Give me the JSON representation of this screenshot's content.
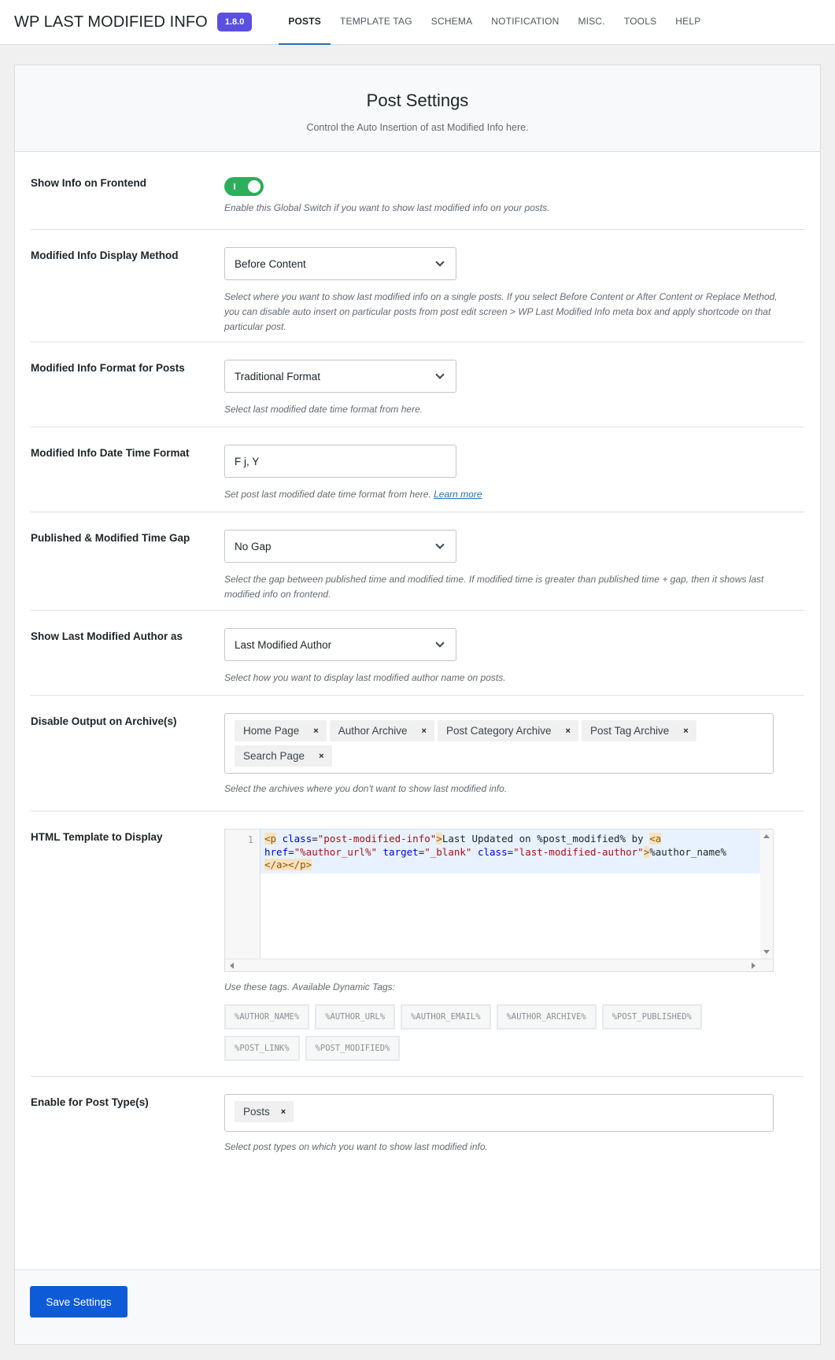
{
  "header": {
    "title": "WP LAST MODIFIED INFO",
    "version": "1.8.0",
    "tabs": [
      {
        "label": "POSTS",
        "active": true
      },
      {
        "label": "TEMPLATE TAG",
        "active": false
      },
      {
        "label": "SCHEMA",
        "active": false
      },
      {
        "label": "NOTIFICATION",
        "active": false
      },
      {
        "label": "MISC.",
        "active": false
      },
      {
        "label": "TOOLS",
        "active": false
      },
      {
        "label": "HELP",
        "active": false
      }
    ]
  },
  "panel": {
    "title": "Post Settings",
    "subtitle": "Control the Auto Insertion of ast Modified Info here."
  },
  "settings": {
    "show_info": {
      "label": "Show Info on Frontend",
      "enabled": true,
      "desc": "Enable this Global Switch if you want to show last modified info on your posts."
    },
    "display_method": {
      "label": "Modified Info Display Method",
      "value": "Before Content",
      "desc": "Select where you want to show last modified info on a single posts. If you select Before Content or After Content or Replace Method, you can disable auto insert on particular posts from post edit screen > WP Last Modified Info meta box and apply shortcode on that particular post."
    },
    "format": {
      "label": "Modified Info Format for Posts",
      "value": "Traditional Format",
      "desc": "Select last modified date time format from here."
    },
    "date_format": {
      "label": "Modified Info Date Time Format",
      "value": "F j, Y",
      "desc": "Set post last modified date time format from here.",
      "link": "Learn more"
    },
    "time_gap": {
      "label": "Published & Modified Time Gap",
      "value": "No Gap",
      "desc": "Select the gap between published time and modified time. If modified time is greater than published time + gap, then it shows last modified info on frontend."
    },
    "author": {
      "label": "Show Last Modified Author as",
      "value": "Last Modified Author",
      "desc": "Select how you want to display last modified author name on posts."
    },
    "archives": {
      "label": "Disable Output on Archive(s)",
      "chips": [
        "Home Page",
        "Author Archive",
        "Post Category Archive",
        "Post Tag Archive",
        "Search Page"
      ],
      "desc": "Select the archives where you don't want to show last modified info."
    },
    "template": {
      "label": "HTML Template to Display",
      "line_number": "1",
      "code": {
        "t1": "<p",
        "a1": "class",
        "s1": "\"post-modified-info\"",
        "t2": ">",
        "txt1": "Last Updated on %post_modified% by ",
        "t3": "<a",
        "a2": "href",
        "s2": "\"%author_url%\"",
        "a3": "target",
        "s3": "\"_blank\"",
        "a4": "class",
        "s4": "\"last-modified-author\"",
        "t4": ">",
        "txt2": "%author_name%",
        "t5": "</a>",
        "t6": "</p>"
      },
      "desc": "Use these tags. Available Dynamic Tags:",
      "tags": [
        "%AUTHOR_NAME%",
        "%AUTHOR_URL%",
        "%AUTHOR_EMAIL%",
        "%AUTHOR_ARCHIVE%",
        "%POST_PUBLISHED%",
        "%POST_LINK%",
        "%POST_MODIFIED%"
      ]
    },
    "post_types": {
      "label": "Enable for Post Type(s)",
      "chips": [
        "Posts"
      ],
      "desc": "Select post types on which you want to show last modified info."
    }
  },
  "footer": {
    "save_label": "Save Settings"
  },
  "colors": {
    "toggle_on": "#2cae5a",
    "primary": "#0d5bd7",
    "badge": "#5a4fe0"
  }
}
